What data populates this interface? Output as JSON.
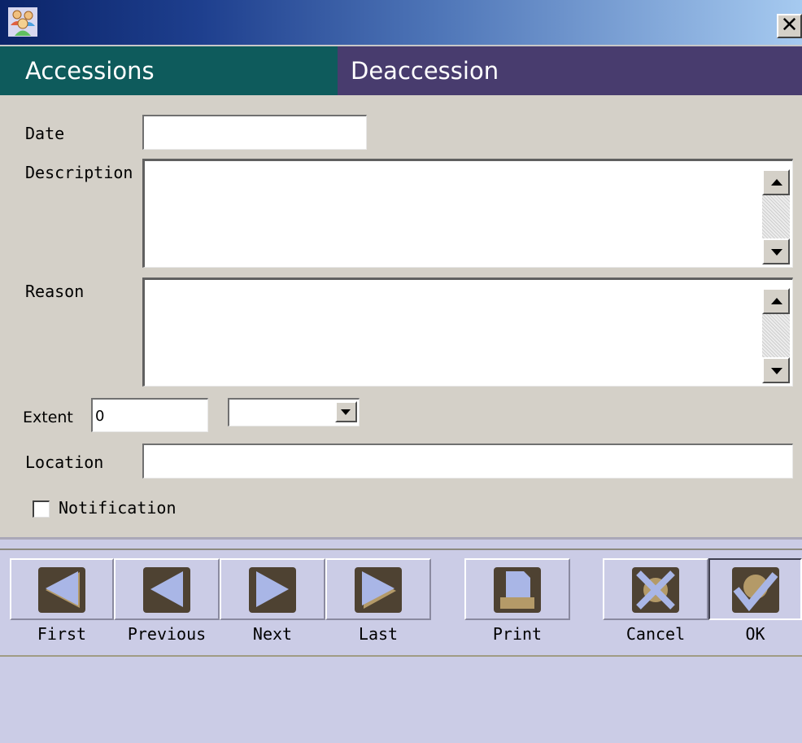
{
  "window": {
    "close_glyph": "✕",
    "icon": "users-icon"
  },
  "header": {
    "left_title": "Accessions",
    "right_title": "Deaccession"
  },
  "form": {
    "date_label": "Date",
    "date_value": "",
    "description_label": "Description",
    "description_value": "",
    "reason_label": "Reason",
    "reason_value": "",
    "extent_label": "Extent",
    "extent_value": "0",
    "extent_unit_selected": "",
    "location_label": "Location",
    "location_value": "",
    "notification_label": "Notification",
    "notification_checked": false
  },
  "toolbar": {
    "first_label": "First",
    "previous_label": "Previous",
    "next_label": "Next",
    "last_label": "Last",
    "print_label": "Print",
    "cancel_label": "Cancel",
    "ok_label": "OK"
  },
  "colors": {
    "accessions_header": "#0e5b5c",
    "deaccession_header": "#483c6e",
    "toolbar_bg": "#cbcce6",
    "icon_dark": "#4e4232",
    "icon_light": "#a9b6e6",
    "icon_tan": "#b49a68"
  }
}
